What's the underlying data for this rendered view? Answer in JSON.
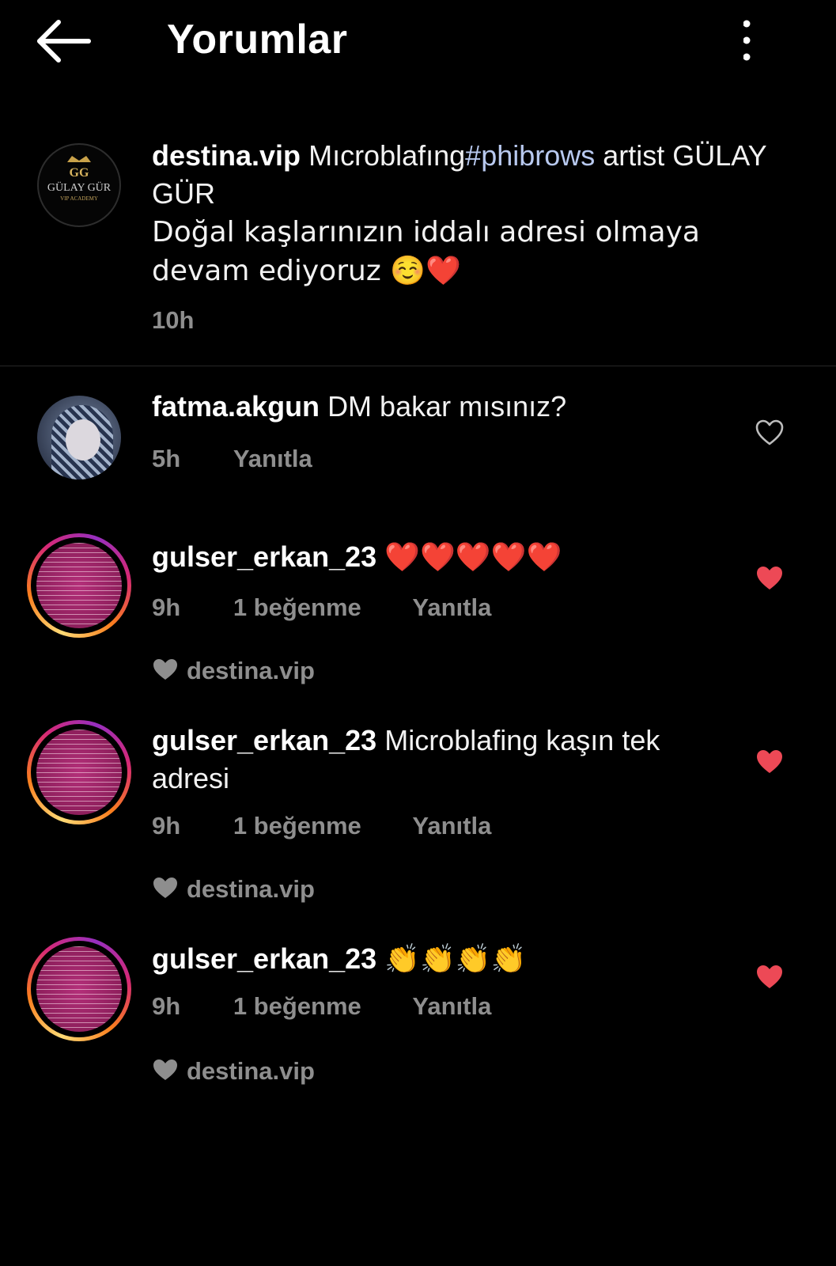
{
  "header": {
    "back_icon": "arrow-left-icon",
    "title": "Yorumlar",
    "more_icon": "more-vertical-icon"
  },
  "caption": {
    "username": "destina.vip",
    "text_before": "Mıcroblafıng",
    "hashtag": "#phibrows",
    "text_after": " artist GÜLAY GÜR",
    "line2": "Doğal kaşlarınızın iddalı adresi olmaya devam ediyoruz ☺️❤️",
    "time": "10h",
    "avatar_icon": "gulay-gur-logo-avatar",
    "logo_text": "GÜLAY GÜR",
    "logo_sub": "VIP ACADEMY"
  },
  "comments": [
    {
      "username": "fatma.akgun",
      "text": "DM bakar mısınız?",
      "time": "5h",
      "likes": "",
      "reply": "Yanıtla",
      "liked": false,
      "liked_by": ""
    },
    {
      "username": "gulser_erkan_23",
      "text": "❤️❤️❤️❤️❤️",
      "time": "9h",
      "likes": "1 beğenme",
      "reply": "Yanıtla",
      "liked": true,
      "liked_by": "destina.vip"
    },
    {
      "username": "gulser_erkan_23",
      "text": "Microblafing kaşın tek adresi",
      "time": "9h",
      "likes": "1 beğenme",
      "reply": "Yanıtla",
      "liked": true,
      "liked_by": "destina.vip"
    },
    {
      "username": "gulser_erkan_23",
      "text": "👏👏👏👏",
      "time": "9h",
      "likes": "1 beğenme",
      "reply": "Yanıtla",
      "liked": true,
      "liked_by": "destina.vip"
    }
  ],
  "colors": {
    "background": "#000000",
    "text": "#f5f5f5",
    "muted": "#8e8e8e",
    "hashtag": "#b8c9ef",
    "liked_heart": "#ed4956"
  }
}
